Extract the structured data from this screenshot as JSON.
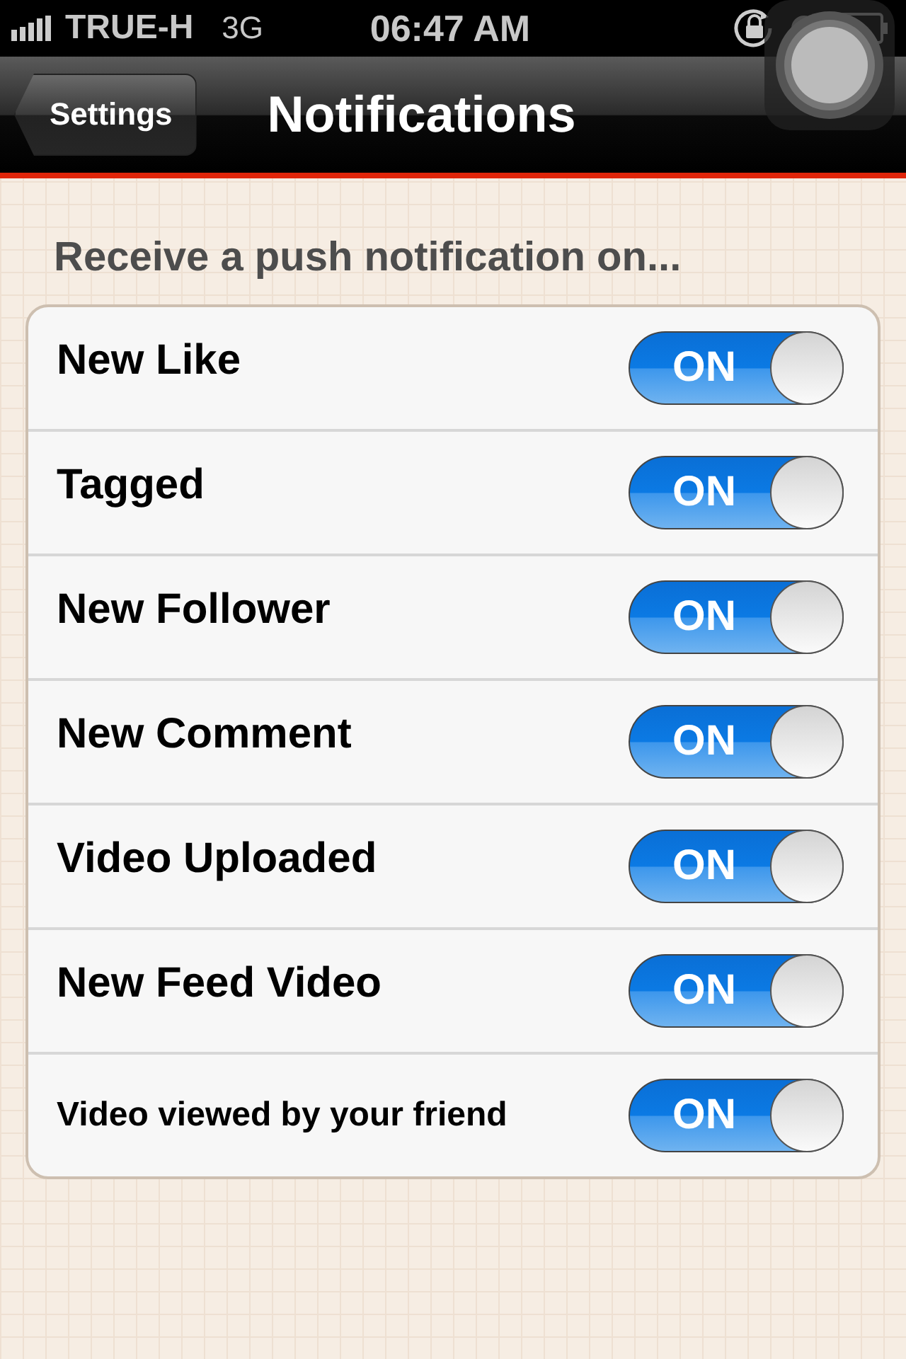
{
  "status_bar": {
    "carrier": "TRUE-H",
    "network": "3G",
    "time": "06:47 AM"
  },
  "nav_bar": {
    "back_button": "Settings",
    "title": "Notifications"
  },
  "section_header": "Receive a push notification on...",
  "settings": [
    {
      "label": "New Like",
      "kind": "large",
      "switch_label": "ON",
      "on": true
    },
    {
      "label": "Tagged",
      "kind": "large",
      "switch_label": "ON",
      "on": true
    },
    {
      "label": "New Follower",
      "kind": "large",
      "switch_label": "ON",
      "on": true
    },
    {
      "label": "New Comment",
      "kind": "large",
      "switch_label": "ON",
      "on": true
    },
    {
      "label": "Video Uploaded",
      "kind": "large",
      "switch_label": "ON",
      "on": true
    },
    {
      "label": "New Feed Video",
      "kind": "large",
      "switch_label": "ON",
      "on": true
    },
    {
      "label": "Video viewed by your friend",
      "kind": "small",
      "switch_label": "ON",
      "on": true
    }
  ]
}
